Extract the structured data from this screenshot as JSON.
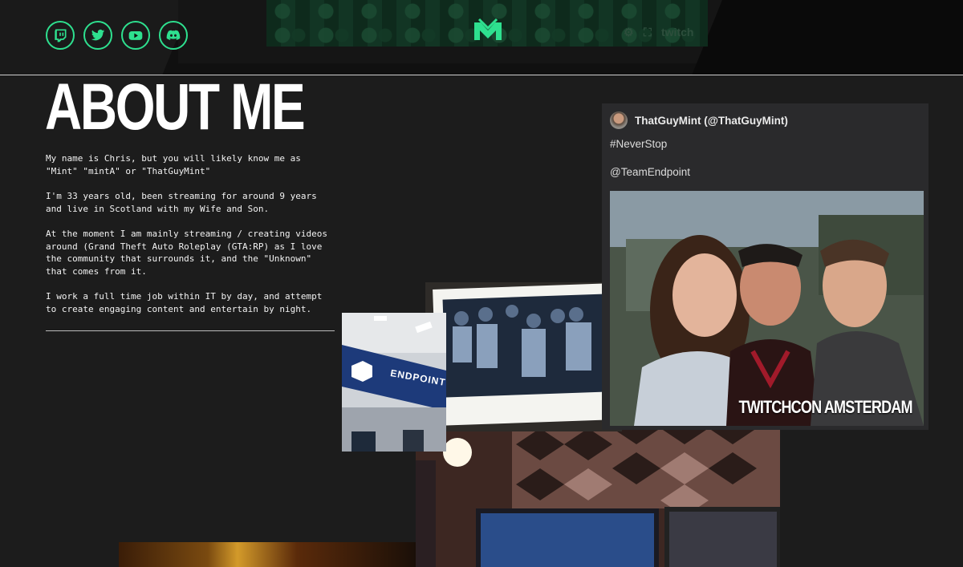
{
  "social": [
    {
      "name": "twitch-icon",
      "label": "Twitch"
    },
    {
      "name": "twitter-icon",
      "label": "Twitter"
    },
    {
      "name": "youtube-icon",
      "label": "YouTube"
    },
    {
      "name": "discord-icon",
      "label": "Discord"
    }
  ],
  "embed": {
    "brand_label": "twitch"
  },
  "about": {
    "title": "ABOUT ME",
    "paragraphs": [
      "My name is Chris, but you will likely know me as \"Mint\" \"mintA\" or \"ThatGuyMint\"",
      "I'm 33 years old, been streaming for around 9 years and live in Scotland with my Wife and Son.",
      "At the moment I am mainly streaming / creating videos around (Grand Theft Auto Roleplay (GTA:RP) as I love the community that surrounds it, and the \"Unknown\" that comes from it.",
      "I work a full time job within IT by day, and attempt to create engaging content and entertain by night."
    ]
  },
  "tweet": {
    "author": "ThatGuyMint (@ThatGuyMint)",
    "line1": "#NeverStop",
    "line2": "@TeamEndpoint",
    "photo_caption": "TWITCHCON AMSTERDAM"
  },
  "photos": {
    "endpoint_sign": "ENDPOINT"
  },
  "colors": {
    "accent": "#2ee08f",
    "background": "#1c1c1c",
    "card": "#2a2a2c"
  }
}
